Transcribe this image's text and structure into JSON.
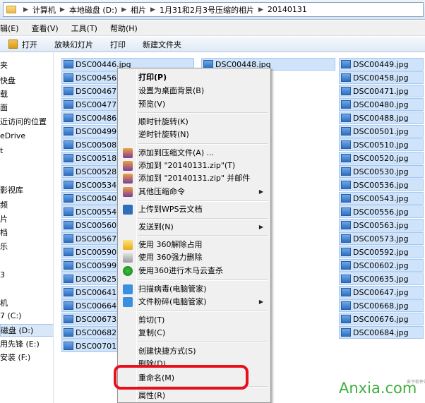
{
  "address": {
    "crumbs": [
      "计算机",
      "本地磁盘 (D:)",
      "相片",
      "1月31和2月3号压缩的相片",
      "20140131"
    ]
  },
  "menubar": {
    "items": [
      "辑(E)",
      "查看(V)",
      "工具(T)",
      "帮助(H)"
    ]
  },
  "toolbar": {
    "open_label": "打开",
    "slideshow_label": "放映幻灯片",
    "print_label": "打印",
    "new_folder_label": "新建文件夹"
  },
  "navpane": {
    "items": [
      "夹",
      "快盘",
      "载",
      "面",
      "近访问的位置",
      "eDrive",
      "t",
      "",
      "影视库",
      "频",
      "片",
      "档",
      "乐",
      "",
      "3",
      "",
      "机",
      "7 (C:)",
      "磁盘 (D:)",
      "用先锋 (E:)",
      "安装 (F:)",
      ""
    ]
  },
  "files": {
    "column1": [
      "DSC00446.jpg",
      "DSC00456.jpg",
      "DSC00467.jpg",
      "DSC00477.jpg",
      "DSC00486.jpg",
      "DSC00499.jpg",
      "DSC00508.jpg",
      "DSC00518.jpg",
      "DSC00528.jpg",
      "DSC00534.jpg",
      "DSC00540.jpg",
      "DSC00554.jpg",
      "DSC00560.jpg",
      "DSC00567.jpg",
      "DSC00590.jpg",
      "DSC00599.jpg",
      "DSC00625.jpg",
      "DSC00641.jpg",
      "DSC00664.jpg",
      "DSC00673.jpg",
      "DSC00682.jpg",
      "DSC00701.jpg"
    ],
    "column2": [
      "DSC00448.jpg"
    ],
    "column3": [
      "DSC00449.jpg",
      "DSC00458.jpg",
      "DSC00471.jpg",
      "DSC00480.jpg",
      "DSC00488.jpg",
      "DSC00501.jpg",
      "DSC00510.jpg",
      "DSC00520.jpg",
      "DSC00530.jpg",
      "DSC00536.jpg",
      "DSC00543.jpg",
      "DSC00556.jpg",
      "DSC00563.jpg",
      "DSC00573.jpg",
      "DSC00592.jpg",
      "DSC00602.jpg",
      "DSC00635.jpg",
      "DSC00647.jpg",
      "DSC00668.jpg",
      "DSC00676.jpg",
      "DSC00684.jpg"
    ]
  },
  "context_menu": {
    "print": "打印(P)",
    "set_wallpaper": "设置为桌面背景(B)",
    "preview": "预览(V)",
    "rotate_cw": "顺时针旋转(K)",
    "rotate_ccw": "逆时针旋转(N)",
    "add_to_archive": "添加到压缩文件(A) ...",
    "add_to_zip": "添加到 \"20140131.zip\"(T)",
    "add_to_zip_email": "添加到 \"20140131.zip\" 并邮件",
    "other_compress": "其他压缩命令",
    "upload_wps": "上传到WPS云文档",
    "send_to": "发送到(N)",
    "unlock_360": "使用 360解除占用",
    "force_delete_360": "使用 360强力删除",
    "trojan_scan_360": "使用360进行木马云查杀",
    "scan_virus": "扫描病毒(电脑管家)",
    "shred": "文件粉碎(电脑管家)",
    "cut": "剪切(T)",
    "copy": "复制(C)",
    "create_shortcut": "创建快捷方式(S)",
    "delete": "删除(D)",
    "rename": "重命名(M)",
    "properties": "属性(R)"
  },
  "watermark": {
    "text": "Anxia.com",
    "sub": "安下软件站"
  },
  "colors": {
    "highlight": "#e8101a",
    "selection": "#cfe3fa",
    "watermark": "#3fae3a"
  }
}
